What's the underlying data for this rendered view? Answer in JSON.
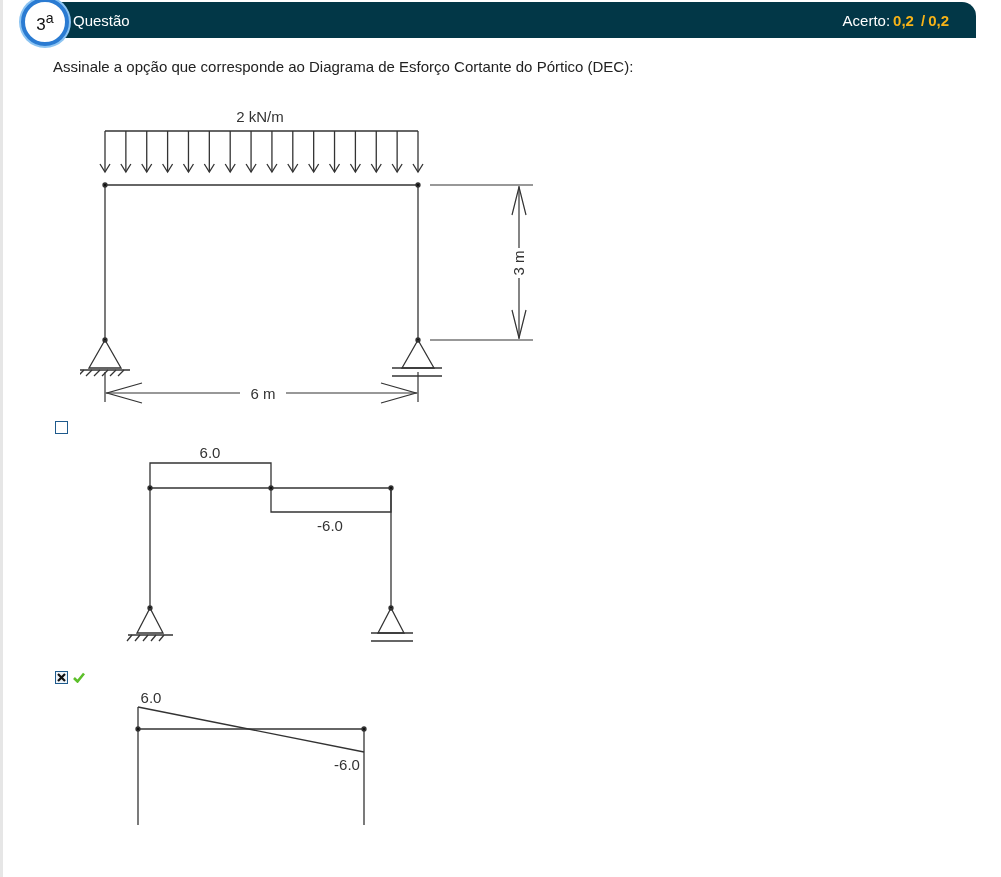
{
  "header": {
    "number": "3$^{a}$",
    "title": "Questão",
    "score_label": "Acerto:",
    "score": "0,2",
    "separator": "/",
    "max_score": "0,2"
  },
  "question": {
    "text": "Assinale a opção que corresponde ao Diagrama de Esforço Cortante do Pórtico (DEC):",
    "figure": {
      "load_label": "2 kN/m",
      "height_label": "3 m",
      "width_label": "6 m"
    }
  },
  "options": [
    {
      "selected": false,
      "correct": false,
      "kind": "step",
      "labels": [
        "6.0",
        "-6.0"
      ]
    },
    {
      "selected": true,
      "correct": true,
      "kind": "linear",
      "labels": [
        "6.0",
        "-6.0"
      ]
    }
  ]
}
